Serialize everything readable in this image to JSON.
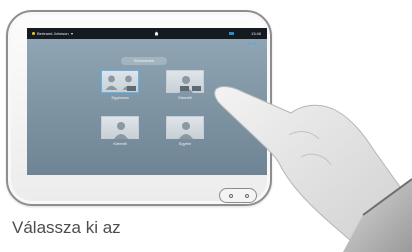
{
  "screen": {
    "user_name": "Bertrand Johnson",
    "user_chevron": "▾",
    "time": "13:46",
    "call_timer": "00:22",
    "layout_button": "Elrendezés",
    "tiles": [
      {
        "label": "Egyforma",
        "selected": true
      },
      {
        "label": "Kiemelt",
        "selected": false
      },
      {
        "label": "Kiemelt",
        "selected": false
      },
      {
        "label": "Egyéni",
        "selected": false
      }
    ]
  },
  "caption": "Válassza ki az",
  "colors": {
    "screen_top": "#93a8b6",
    "status_bar": "#141a20",
    "accent_blue": "#4aa3df",
    "caption_text": "#4d4d4d"
  },
  "icons": [
    "status-dot-icon",
    "home-icon",
    "call-icon",
    "person-icon",
    "home-button-icon"
  ]
}
